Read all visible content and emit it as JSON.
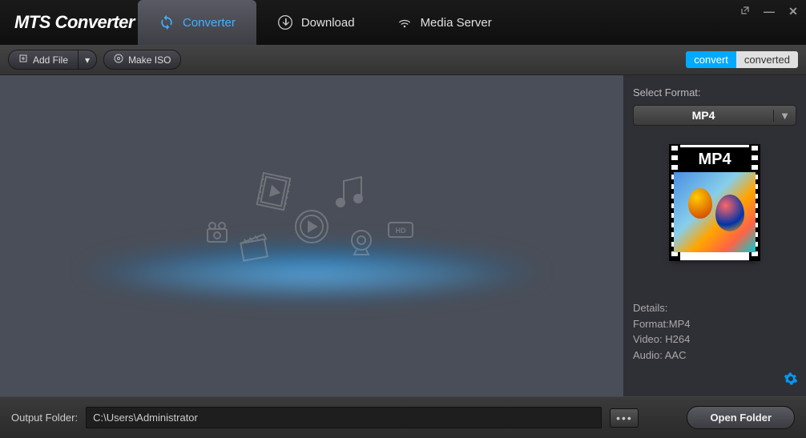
{
  "app": {
    "title": "MTS Converter"
  },
  "tabs": {
    "converter": "Converter",
    "download": "Download",
    "media_server": "Media Server"
  },
  "toolbar": {
    "add_file": "Add File",
    "make_iso": "Make ISO",
    "convert": "convert",
    "converted": "converted"
  },
  "sidebar": {
    "select_format_label": "Select Format:",
    "selected_format": "MP4",
    "preview_label": "MP4",
    "details_label": "Details:",
    "format_line": "Format:MP4",
    "video_line": "Video: H264",
    "audio_line": "Audio: AAC"
  },
  "footer": {
    "output_label": "Output Folder:",
    "output_path": "C:\\Users\\Administrator",
    "open_folder": "Open Folder"
  }
}
